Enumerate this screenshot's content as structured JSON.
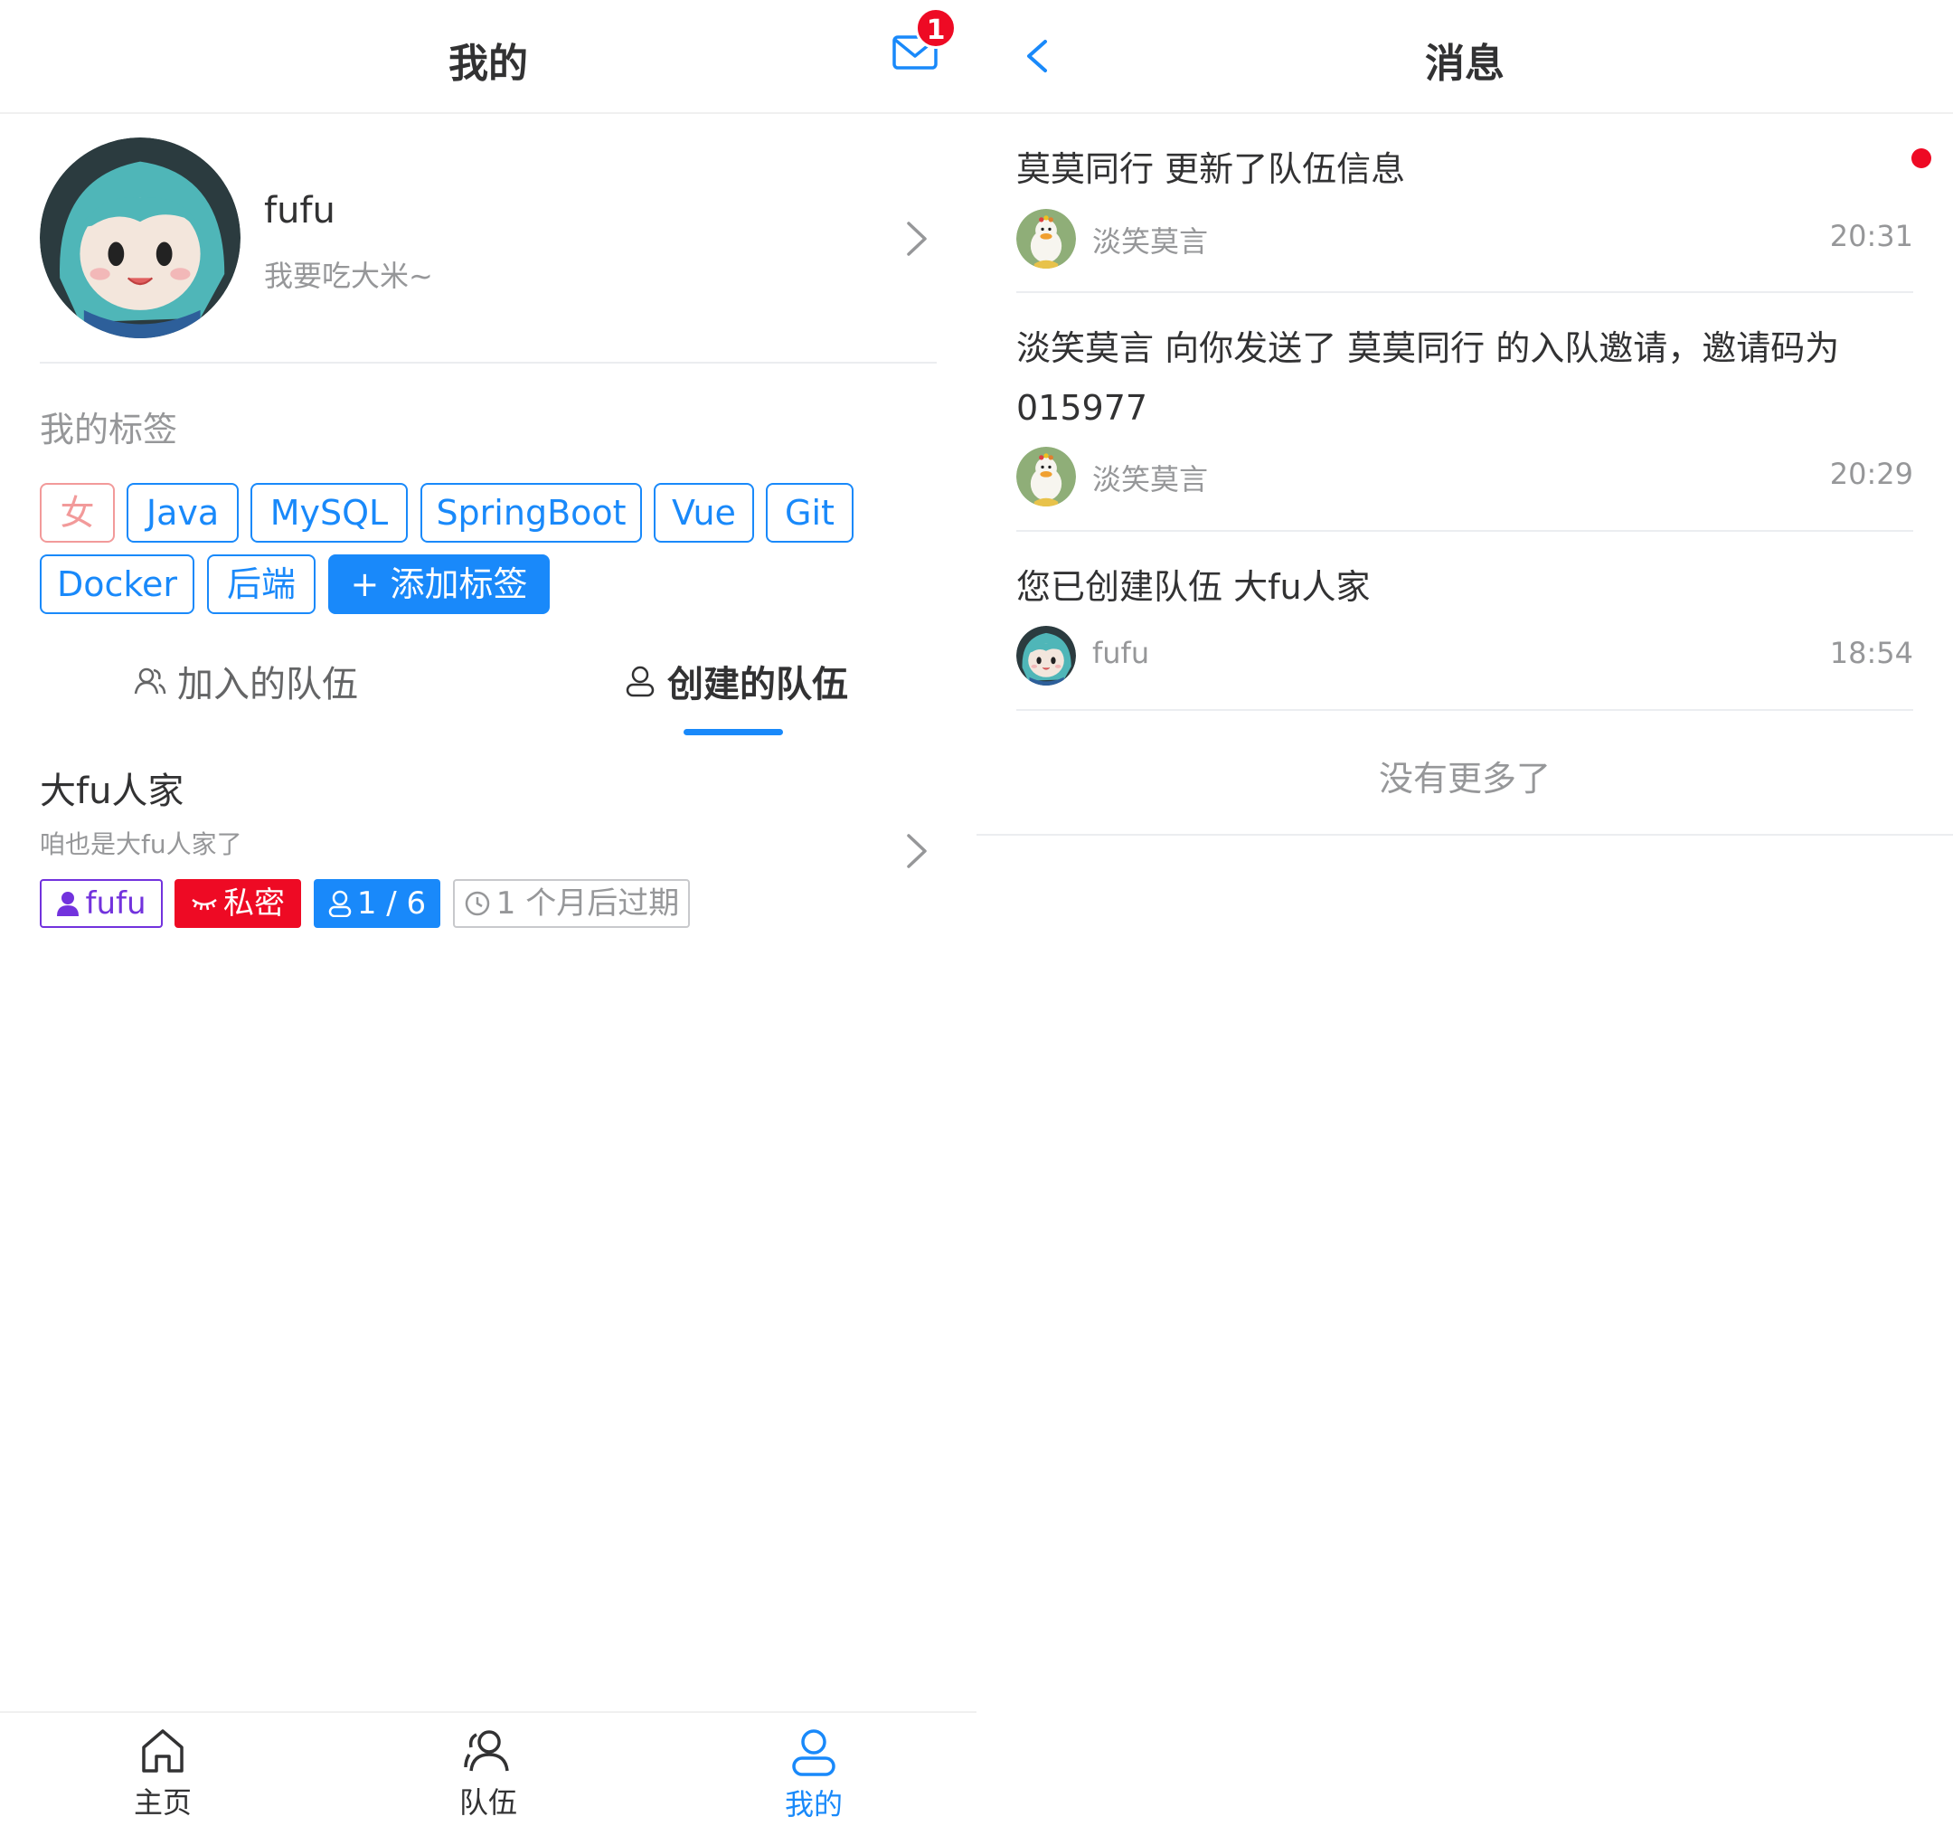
{
  "colors": {
    "primary": "#1989fa",
    "danger": "#ee0a24",
    "owner": "#7232dd",
    "muted": "#969799",
    "gender_tag": "#f29a9a"
  },
  "left": {
    "nav": {
      "title": "我的",
      "mail_icon": "mail-icon",
      "badge": "1"
    },
    "profile": {
      "name": "fufu",
      "bio": "我要吃大米~"
    },
    "tags": {
      "label": "我的标签",
      "row1": [
        "女",
        "Java",
        "MySQL",
        "SpringBoot",
        "Vue",
        "Git"
      ],
      "row2": [
        "Docker",
        "后端"
      ],
      "add_label": "+ 添加标签"
    },
    "tabs": {
      "joined": "加入的队伍",
      "created": "创建的队伍"
    },
    "team": {
      "name": "大fu人家",
      "description": "咱也是大fu人家了",
      "owner": "fufu",
      "visibility": "私密",
      "members": "1 / 6",
      "expire": "1 个月后过期"
    },
    "tabbar": [
      {
        "label": "主页",
        "icon": "home-icon"
      },
      {
        "label": "队伍",
        "icon": "team-icon"
      },
      {
        "label": "我的",
        "icon": "user-icon"
      }
    ]
  },
  "right": {
    "nav": {
      "title": "消息",
      "back_icon": "chevron-left-icon"
    },
    "messages": [
      {
        "title": "莫莫同行 更新了队伍信息",
        "sender": "淡笑莫言",
        "time": "20:31",
        "unread": true
      },
      {
        "title": "淡笑莫言 向你发送了 莫莫同行 的入队邀请，邀请码为 015977",
        "sender": "淡笑莫言",
        "time": "20:29",
        "unread": false
      },
      {
        "title": "您已创建队伍 大fu人家",
        "sender": "fufu",
        "time": "18:54",
        "unread": false
      }
    ],
    "footer": "没有更多了"
  }
}
